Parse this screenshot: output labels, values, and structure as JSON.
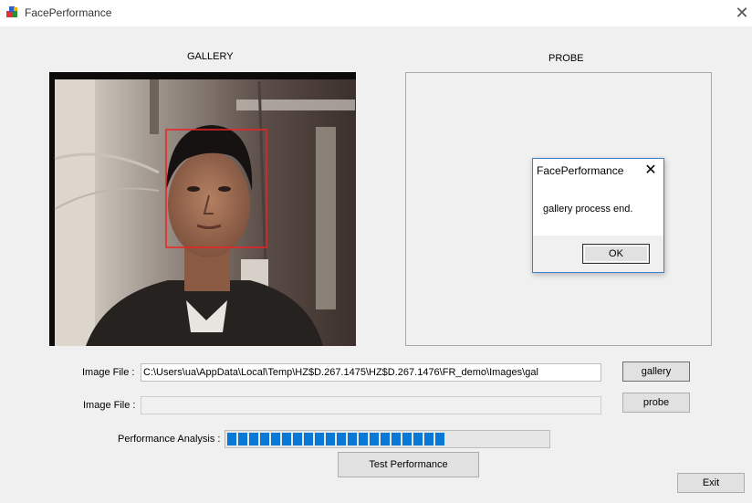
{
  "window": {
    "title": "FacePerformance",
    "icon": "app-cube-icon",
    "close_glyph": "✕"
  },
  "gallery": {
    "label": "GALLERY"
  },
  "probe": {
    "label": "PROBE"
  },
  "fields": {
    "gallery_label": "Image File :",
    "gallery_path": "C:\\Users\\ua\\AppData\\Local\\Temp\\HZ$D.267.1475\\HZ$D.267.1476\\FR_demo\\Images\\gal",
    "probe_label": "Image File :",
    "probe_path": ""
  },
  "buttons": {
    "gallery": "gallery",
    "probe": "probe",
    "test": "Test Performance",
    "exit": "Exit"
  },
  "performance": {
    "label": "Performance Analysis :",
    "progress_fraction": 0.69,
    "segment_color": "#0a78d7"
  },
  "dialog": {
    "title": "FacePerformance",
    "close_glyph": "✕",
    "message": "gallery process end.",
    "ok": "OK"
  }
}
